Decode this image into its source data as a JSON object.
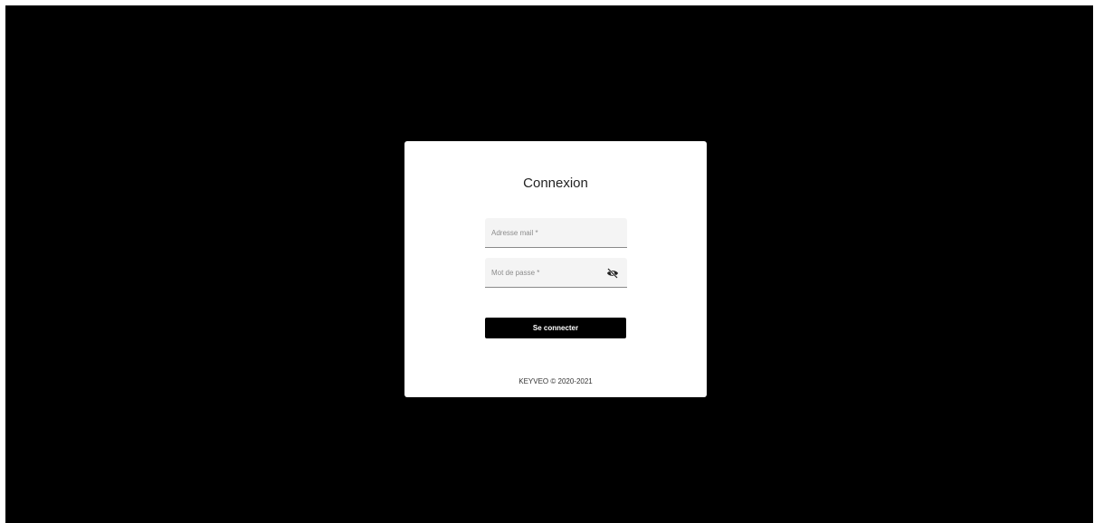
{
  "login": {
    "title": "Connexion",
    "email": {
      "placeholder": "Adresse mail *",
      "value": ""
    },
    "password": {
      "placeholder": "Mot de passe *",
      "value": "",
      "toggle_icon": "eye-off-icon"
    },
    "submit_label": "Se connecter",
    "footer": "KEYVEO © 2020-2021"
  },
  "colors": {
    "background": "#000000",
    "card": "#ffffff",
    "field_background": "#f4f4f4",
    "button": "#000000",
    "button_text": "#ffffff"
  }
}
